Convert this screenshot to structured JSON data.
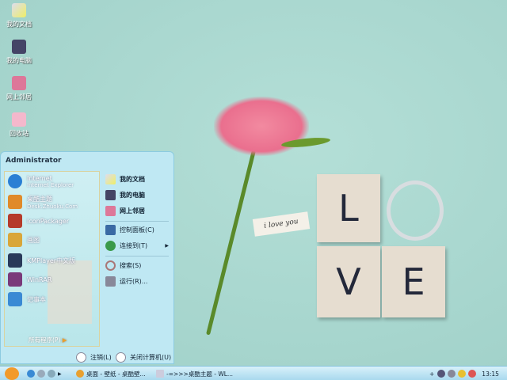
{
  "desktop": {
    "icons": [
      {
        "label": "我的文档",
        "icon": "my-documents-icon"
      },
      {
        "label": "我的电脑",
        "icon": "my-computer-icon"
      },
      {
        "label": "网上邻居",
        "icon": "network-places-icon"
      },
      {
        "label": "回收站",
        "icon": "recycle-bin-icon"
      }
    ],
    "wallpaper": {
      "tag": "i love you",
      "letters": [
        "L",
        "O",
        "V",
        "E"
      ]
    }
  },
  "start_menu": {
    "user": "Administrator",
    "programs": [
      {
        "title": "Internet",
        "sub": "Internet Explorer",
        "color": "#2a7fd4"
      },
      {
        "title": "桌酷主题",
        "sub": "Desk.Zhuoku.Com",
        "color": "#e08a2a"
      },
      {
        "title": "IconPackager",
        "sub": "",
        "color": "#b53a2a"
      },
      {
        "title": "画图",
        "sub": "",
        "color": "#d9a63a"
      },
      {
        "title": "KMPlayer中文版",
        "sub": "",
        "color": "#2a3a5a"
      },
      {
        "title": "WinRAR",
        "sub": "",
        "color": "#7a3a7a"
      },
      {
        "title": "记事本",
        "sub": "",
        "color": "#3a8ad4"
      }
    ],
    "all_programs": "所有程序(P)",
    "places": [
      {
        "label": "我的文档"
      },
      {
        "label": "我的电脑"
      },
      {
        "label": "网上邻居"
      }
    ],
    "system": [
      {
        "label": "控制面板(C)"
      },
      {
        "label": "连接到(T)"
      }
    ],
    "tools": [
      {
        "label": "搜索(S)"
      },
      {
        "label": "运行(R)..."
      }
    ],
    "logoff": "注销(L)",
    "shutdown": "关闭计算机(U)"
  },
  "taskbar": {
    "tasks": [
      {
        "label": "桌面 - 壁纸 - 桌酷壁..."
      },
      {
        "label": "-=>>>桌酷主题 - WL..."
      }
    ],
    "clock": "13:15",
    "tray_expand": "+"
  }
}
